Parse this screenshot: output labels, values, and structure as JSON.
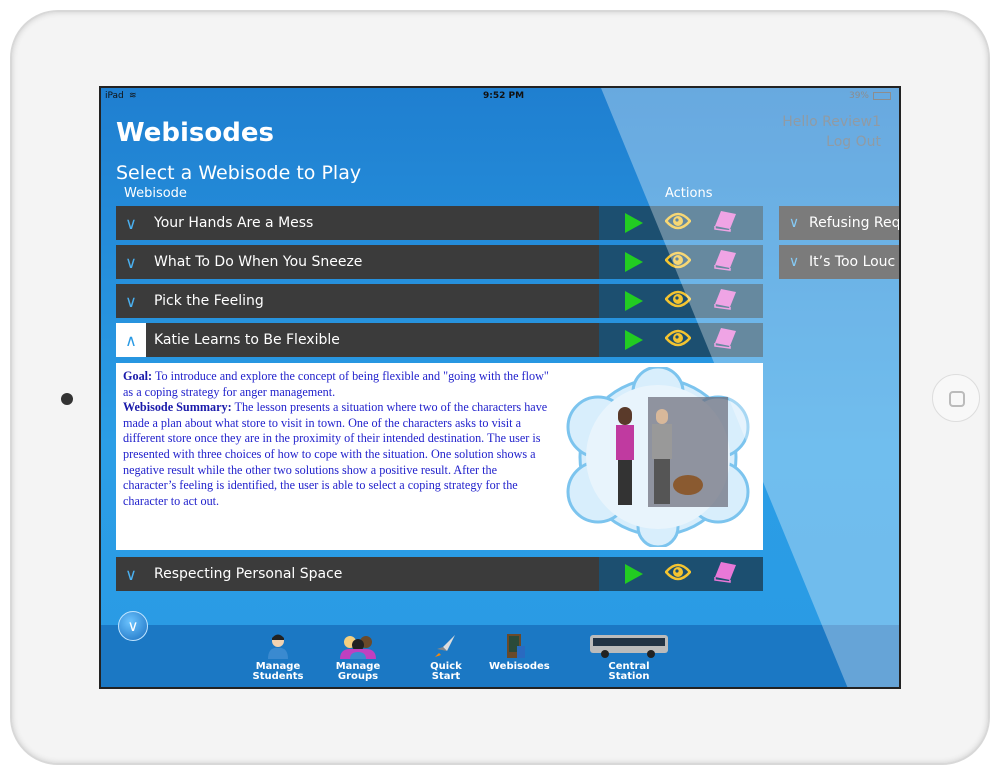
{
  "status": {
    "device": "iPad",
    "time": "9:52 PM",
    "battery": "39%"
  },
  "header": {
    "title": "Webisodes",
    "subtitle": "Select a Webisode to Play",
    "greeting": "Hello Review1",
    "logout": "Log Out"
  },
  "columns": {
    "webisode": "Webisode",
    "actions": "Actions"
  },
  "webisodes": [
    {
      "title": "Your Hands Are a Mess",
      "expanded": false
    },
    {
      "title": "What To Do When You Sneeze",
      "expanded": false
    },
    {
      "title": "Pick the Feeling",
      "expanded": false
    },
    {
      "title": "Katie Learns to Be Flexible",
      "expanded": true
    },
    {
      "title": "Respecting Personal Space",
      "expanded": false
    }
  ],
  "right_webisodes": [
    "Refusing Req",
    "It’s Too Louc"
  ],
  "details": {
    "goal_label": "Goal:",
    "goal": " To introduce and explore the concept of being flexible and \"going with the flow\" as a coping strategy for anger management.",
    "summary_label": "Webisode Summary:",
    "summary": " The lesson presents a situation where two of the characters have made a plan about what store to visit in town. One of the characters asks to visit a different store once they are in the proximity of their intended destination. The user is presented with three choices of how to cope with the situation. One solution shows a negative result while the other two solutions show a positive result. After the character’s feeling is identified, the user is able to select a coping strategy for the character to act out."
  },
  "toolbar": [
    {
      "l1": "Manage",
      "l2": "Students"
    },
    {
      "l1": "Manage",
      "l2": "Groups"
    },
    {
      "l1": "Quick",
      "l2": "Start"
    },
    {
      "l1": "Webisodes",
      "l2": ""
    },
    {
      "l1": "Central Station",
      "l2": ""
    }
  ],
  "colors": {
    "play": "#22cc22",
    "eye": "#f4c430",
    "book": "#e878d8",
    "row": "#3b3b3b",
    "accent": "#2a9ae4"
  }
}
